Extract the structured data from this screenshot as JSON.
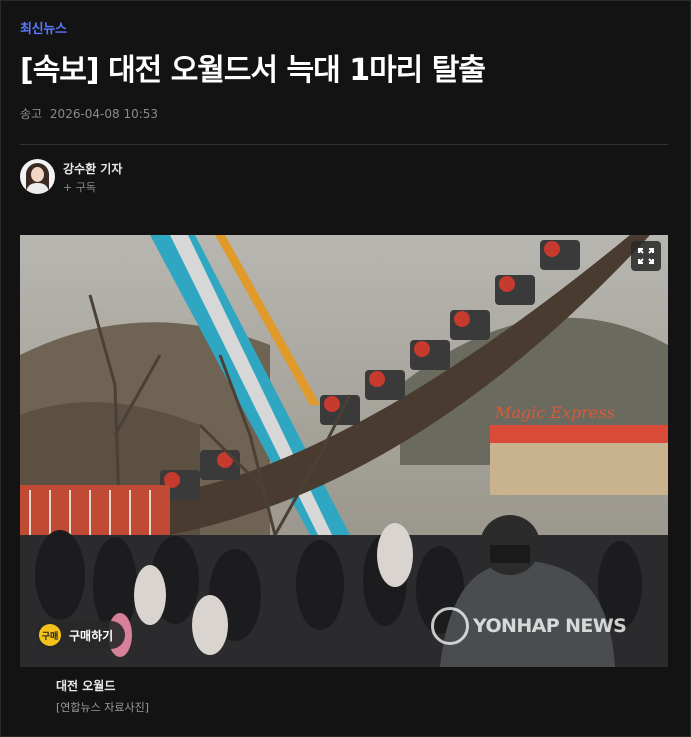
{
  "article": {
    "category": "최신뉴스",
    "headline": "[속보] 대전 오월드서 늑대 1마리 탈출",
    "published_label": "송고",
    "published_at": "2026-04-08 10:53"
  },
  "author": {
    "name": "강수환 기자",
    "subscribe_label": "+ 구독"
  },
  "photo": {
    "buy_icon_text": "구매",
    "buy_label": "구매하기",
    "watermark": "YONHAP NEWS",
    "sign_text": "Magic Express",
    "expand_icon": "expand-icon",
    "caption_title": "대전 오월드",
    "caption_credit": "[연합뉴스 자료사진]"
  },
  "colors": {
    "background": "#131313",
    "category": "#5b78ff",
    "buy_badge": "#f2c21b"
  }
}
